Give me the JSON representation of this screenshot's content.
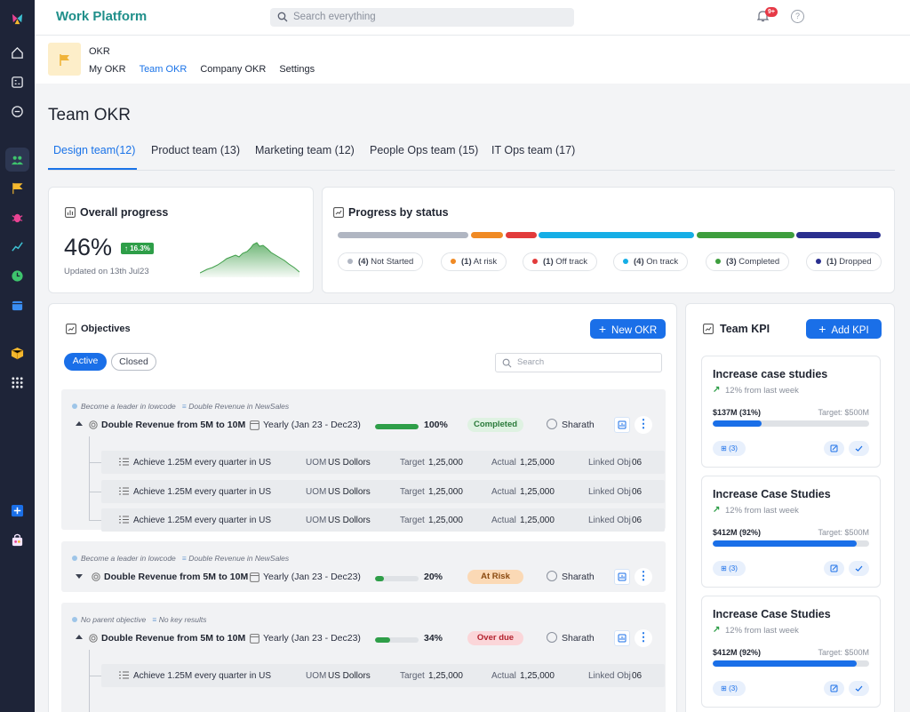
{
  "app": {
    "brand": "Work Platform",
    "search_placeholder": "Search everything",
    "notif_count": "9+",
    "help": "?"
  },
  "module": {
    "title": "OKR",
    "nav": [
      "My OKR",
      "Team OKR",
      "Company OKR",
      "Settings"
    ],
    "active_nav": "Team OKR"
  },
  "page": {
    "title": "Team OKR"
  },
  "team_tabs": [
    {
      "label": "Design team(12)",
      "active": true
    },
    {
      "label": "Product team (13)"
    },
    {
      "label": "Marketing team (12)"
    },
    {
      "label": "People Ops team (15)"
    },
    {
      "label": "IT Ops team (17)"
    }
  ],
  "overall": {
    "title": "Overall progress",
    "value": "46%",
    "delta": "16.3%",
    "updated": "Updated on 13th Jul23"
  },
  "by_status": {
    "title": "Progress by status",
    "items": [
      {
        "count": "(4)",
        "label": "Not Started",
        "color": "#b0b6c2"
      },
      {
        "count": "(1)",
        "label": "At risk",
        "color": "#f08a24"
      },
      {
        "count": "(1)",
        "label": "Off track",
        "color": "#e23b3b"
      },
      {
        "count": "(4)",
        "label": "On track",
        "color": "#15aee6"
      },
      {
        "count": "(3)",
        "label": "Completed",
        "color": "#3e9e3e"
      },
      {
        "count": "(1)",
        "label": "Dropped",
        "color": "#2a2f8f"
      }
    ]
  },
  "objectives": {
    "title": "Objectives",
    "new_button": "New OKR",
    "filter_active": "Active",
    "filter_closed": "Closed",
    "search_placeholder": "Search",
    "groups": [
      {
        "parent": "Become a leader in lowcode",
        "key_result": "Double Revenue in NewSales",
        "name": "Double Revenue from 5M to 10M",
        "period": "Yearly (Jan 23 - Dec23)",
        "progress": 100,
        "progress_label": "100%",
        "status": "Completed",
        "owner": "Sharath",
        "krs": [
          {
            "name": "Achieve 1.25M every quarter in US",
            "uom_label": "UOM",
            "uom": "US Dollors",
            "target_label": "Target",
            "target": "1,25,000",
            "actual_label": "Actual",
            "actual": "1,25,000",
            "linked_label": "Linked Obj",
            "linked": "06"
          },
          {
            "name": "Achieve 1.25M every quarter in US",
            "uom_label": "UOM",
            "uom": "US Dollors",
            "target_label": "Target",
            "target": "1,25,000",
            "actual_label": "Actual",
            "actual": "1,25,000",
            "linked_label": "Linked Obj",
            "linked": "06"
          },
          {
            "name": "Achieve 1.25M every quarter in US",
            "uom_label": "UOM",
            "uom": "US Dollors",
            "target_label": "Target",
            "target": "1,25,000",
            "actual_label": "Actual",
            "actual": "1,25,000",
            "linked_label": "Linked Obj",
            "linked": "06"
          }
        ]
      },
      {
        "parent": "Become a leader in lowcode",
        "key_result": "Double Revenue in NewSales",
        "name": "Double Revenue from 5M to 10M",
        "period": "Yearly (Jan 23 - Dec23)",
        "progress": 20,
        "progress_label": "20%",
        "status": "At Risk",
        "owner": "Sharath"
      },
      {
        "parent": "No parent objective",
        "key_result": "No key results",
        "name": "Double Revenue from 5M to 10M",
        "period": "Yearly (Jan 23 - Dec23)",
        "progress": 34,
        "progress_label": "34%",
        "status": "Over due",
        "owner": "Sharath",
        "krs": [
          {
            "name": "Achieve 1.25M every quarter in US",
            "uom_label": "UOM",
            "uom": "US Dollors",
            "target_label": "Target",
            "target": "1,25,000",
            "actual_label": "Actual",
            "actual": "1,25,000",
            "linked_label": "Linked Obj",
            "linked": "06"
          }
        ]
      }
    ]
  },
  "team_kpi": {
    "title": "Team KPI",
    "add_button": "Add KPI",
    "cards": [
      {
        "title": "Increase case studies",
        "trend": "12% from last week",
        "value": "$137M (31%)",
        "target": "Target:  $500M",
        "progress": 31,
        "chip": "(3)"
      },
      {
        "title": "Increase Case Studies",
        "trend": "12% from last week",
        "value": "$412M (92%)",
        "target": "Target:  $500M",
        "progress": 92,
        "chip": "(3)"
      },
      {
        "title": "Increase Case Studies",
        "trend": "12% from last week",
        "value": "$412M (92%)",
        "target": "Target:  $500M",
        "progress": 92,
        "chip": "(3)"
      }
    ]
  }
}
